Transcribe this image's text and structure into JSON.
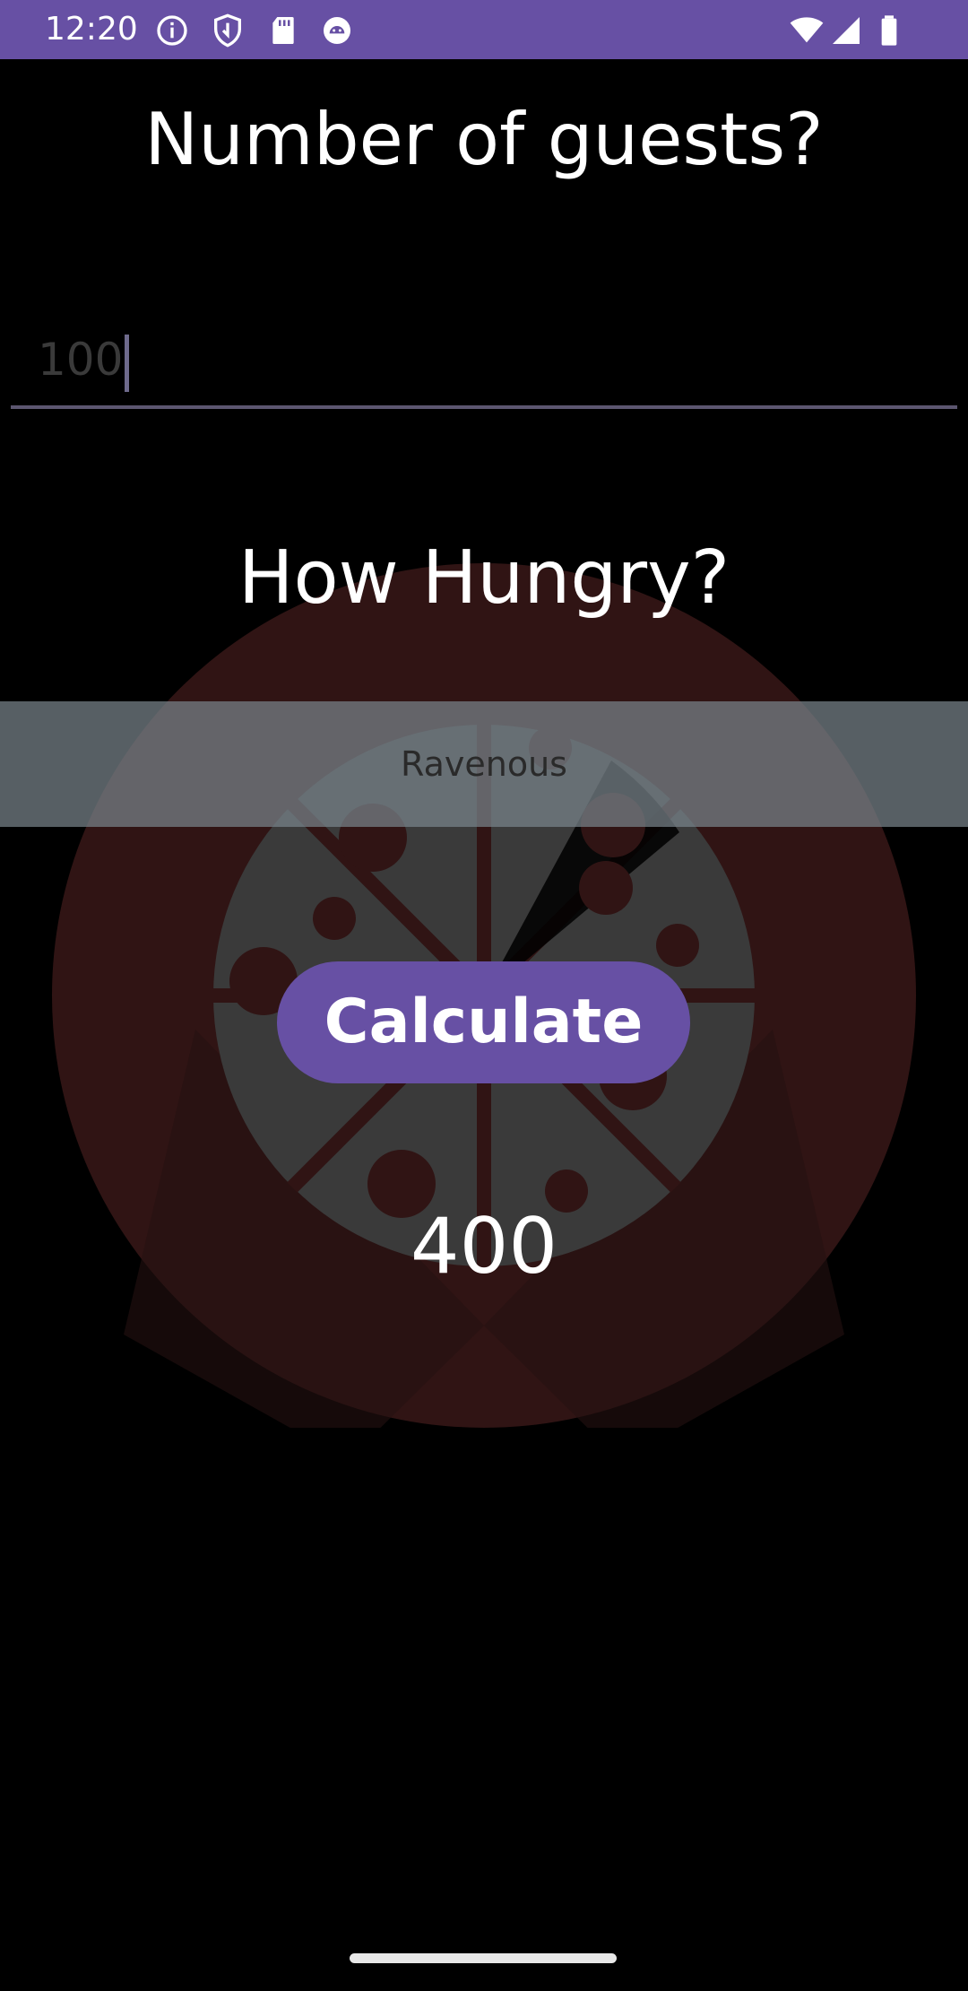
{
  "status_bar": {
    "time": "12:20",
    "background": "#6750a4",
    "left_icons": [
      "info-icon",
      "shield-icon",
      "sd-card-icon",
      "android-debug-icon"
    ],
    "right_icons": [
      "wifi-icon",
      "signal-icon",
      "battery-icon"
    ]
  },
  "guests": {
    "label": "Number of guests?",
    "value": "100"
  },
  "hungry": {
    "label": "How Hungry?",
    "selected": "Ravenous"
  },
  "calculate_button": {
    "label": "Calculate"
  },
  "result": {
    "value": "400"
  },
  "colors": {
    "accent": "#6750a4",
    "background": "#000000",
    "pizza_plate": "#301414"
  }
}
